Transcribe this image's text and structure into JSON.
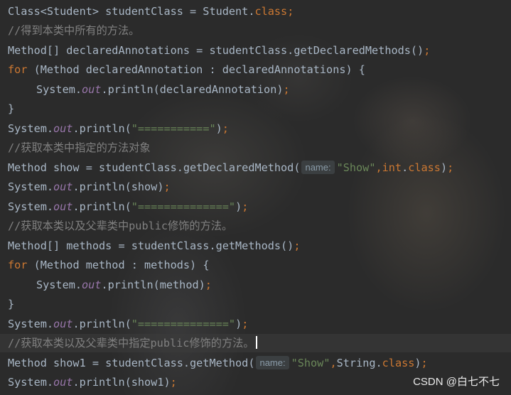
{
  "code": {
    "l1": {
      "type": "Class<Student> studentClass = Student.",
      "kw": "class",
      "semi": ";"
    },
    "l2": {
      "comment": "//得到本类中所有的方法。"
    },
    "l3": {
      "text": "Method[] declaredAnnotations = studentClass.getDeclaredMethods()",
      "semi": ";"
    },
    "l4": {
      "kw": "for",
      "text": " (Method declaredAnnotation : declaredAnnotations) {"
    },
    "l5": {
      "pre": "System.",
      "field": "out",
      "post": ".println(declaredAnnotation)",
      "semi": ";"
    },
    "l6": {
      "text": "}"
    },
    "l7": {
      "pre": "System.",
      "field": "out",
      "post": ".println(",
      "str": "\"===========\"",
      "end": ")",
      "semi": ";"
    },
    "l8": {
      "comment": "//获取本类中指定的方法对象"
    },
    "l9": {
      "pre": "Method show = studentClass.getDeclaredMethod(",
      "hint": "name:",
      "str": "\"Show\"",
      "comma": ",",
      "kw1": "int",
      "dot": ".",
      "kw2": "class",
      "end": ")",
      "semi": ";"
    },
    "l10": {
      "pre": "System.",
      "field": "out",
      "post": ".println(show)",
      "semi": ";"
    },
    "l11": {
      "pre": "System.",
      "field": "out",
      "post": ".println(",
      "str": "\"==============\"",
      "end": ")",
      "semi": ";"
    },
    "l12": {
      "comment": "//获取本类以及父辈类中public修饰的方法。"
    },
    "l13": {
      "text": "Method[] methods = studentClass.getMethods()",
      "semi": ";"
    },
    "l14": {
      "kw": "for",
      "text": " (Method method : methods) {"
    },
    "l15": {
      "pre": "System.",
      "field": "out",
      "post": ".println(method)",
      "semi": ";"
    },
    "l16": {
      "text": "}"
    },
    "l17": {
      "pre": "System.",
      "field": "out",
      "post": ".println(",
      "str": "\"==============\"",
      "end": ")",
      "semi": ";"
    },
    "l18": {
      "comment": "//获取本类以及父辈类中指定public修饰的方法。"
    },
    "l19": {
      "pre": "Method show1 = studentClass.getMethod(",
      "hint": "name:",
      "str": "\"Show\"",
      "comma": ",",
      "mid": "String.",
      "kw2": "class",
      "end": ")",
      "semi": ";"
    },
    "l20": {
      "pre": "System.",
      "field": "out",
      "post": ".println(show1)",
      "semi": ";"
    }
  },
  "watermark": "CSDN @白七不七",
  "colors": {
    "background": "#2b2b2b",
    "default_text": "#a9b7c6",
    "keyword": "#cc7832",
    "comment": "#808080",
    "string": "#6a8759",
    "static_field": "#9876aa"
  }
}
